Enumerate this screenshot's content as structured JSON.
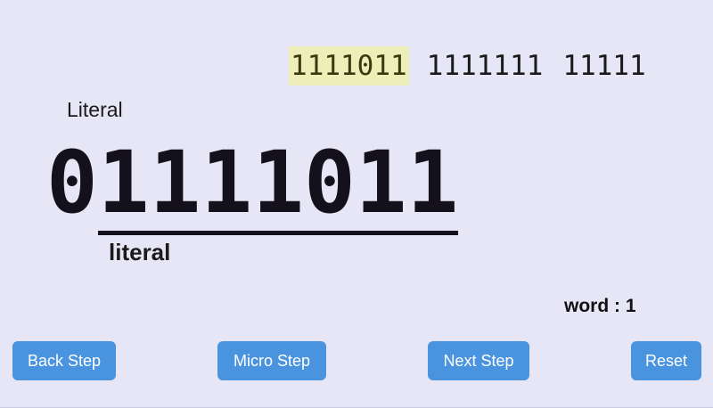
{
  "stream": {
    "words": [
      "1111011",
      "1111111",
      "11111"
    ],
    "current_index": 0
  },
  "decoder": {
    "mode_label": "Literal",
    "flag_bit": "0",
    "payload_bits": "1111011",
    "payload_label": "literal",
    "word_counter": "word : 1"
  },
  "controls": {
    "back_step": "Back Step",
    "micro_step": "Micro Step",
    "next_step": "Next Step",
    "reset": "Reset"
  },
  "colors": {
    "background": "#e6e6f7",
    "highlight": "#eeeeb9",
    "button": "#4a94df",
    "button_text": "#ffffff"
  }
}
